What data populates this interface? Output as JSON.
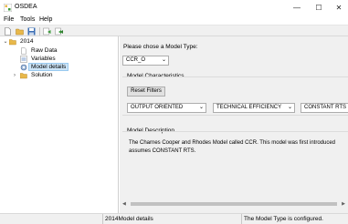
{
  "window": {
    "title": "OSDEA",
    "minimize_glyph": "—",
    "maximize_glyph": "☐",
    "close_glyph": "✕"
  },
  "menu": {
    "file": "File",
    "tools": "Tools",
    "help": "Help"
  },
  "toolbar": {
    "buttons": [
      "new-file-icon",
      "open-folder-icon",
      "save-icon",
      "run-icon",
      "run-all-icon"
    ]
  },
  "tree": {
    "root": "2014",
    "items": [
      "Raw Data",
      "Variables",
      "Model details",
      "Solution"
    ],
    "selected": "Model details"
  },
  "model": {
    "type_prompt": "Please chose a Model Type:",
    "type_value": "CCR_O",
    "characteristics_label": "Model Characteristics",
    "reset_button": "Reset Filters",
    "filters": [
      "OUTPUT ORIENTED",
      "TECHNICAL EFFICIENCY",
      "CONSTANT RTS"
    ],
    "description_label": "Model Description",
    "description_line1": "The Charnes Cooper and Rhodes Model called CCR. This model was first introduced",
    "description_line2": "assumes CONSTANT RTS."
  },
  "status": {
    "year": "2014",
    "section": "Model details",
    "message": "The Model Type is configured."
  },
  "colors": {
    "selection": "#cce4f7",
    "folder": "#e8b84a",
    "green": "#3a9a3a"
  }
}
